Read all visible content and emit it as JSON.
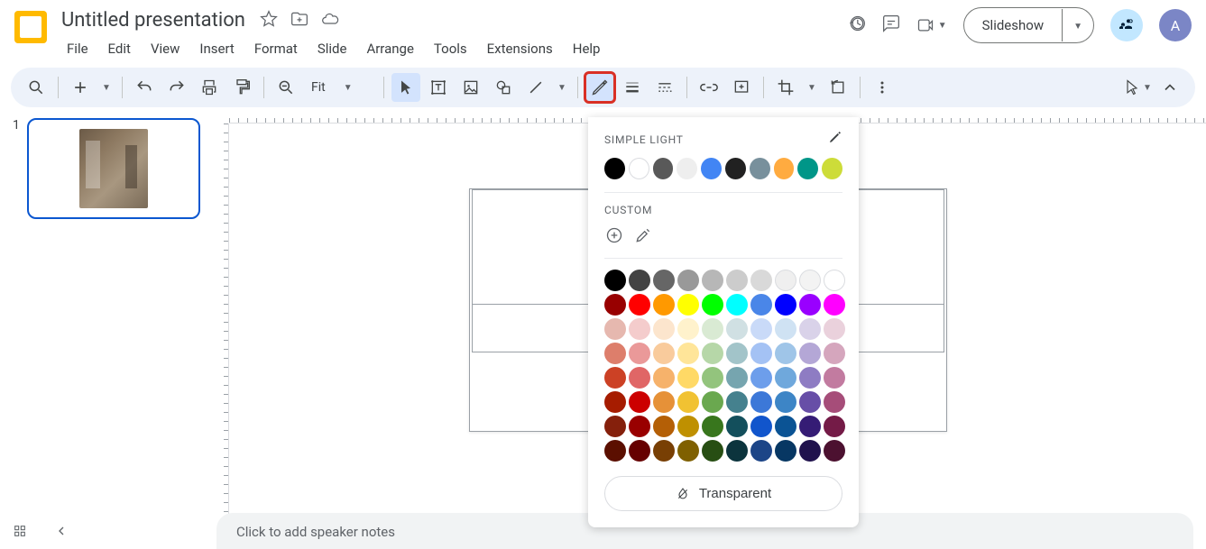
{
  "header": {
    "title": "Untitled presentation",
    "avatar_initial": "A",
    "slideshow_label": "Slideshow"
  },
  "menus": [
    "File",
    "Edit",
    "View",
    "Insert",
    "Format",
    "Slide",
    "Arrange",
    "Tools",
    "Extensions",
    "Help"
  ],
  "toolbar": {
    "zoom_label": "Fit"
  },
  "sidebar": {
    "slides": [
      {
        "number": "1"
      }
    ]
  },
  "notes": {
    "placeholder": "Click to add speaker notes"
  },
  "popover": {
    "section1_title": "SIMPLE LIGHT",
    "section2_title": "CUSTOM",
    "transparent_label": "Transparent",
    "theme_colors": [
      "#000000",
      "#ffffff",
      "#595959",
      "#eeeeee",
      "#4285f4",
      "#212121",
      "#78909c",
      "#ffab40",
      "#009688",
      "#cddc39"
    ],
    "palette_rows": [
      [
        "#000000",
        "#434343",
        "#666666",
        "#999999",
        "#b7b7b7",
        "#cccccc",
        "#d9d9d9",
        "#efefef",
        "#f3f3f3",
        "#ffffff"
      ],
      [
        "#980000",
        "#ff0000",
        "#ff9900",
        "#ffff00",
        "#00ff00",
        "#00ffff",
        "#4a86e8",
        "#0000ff",
        "#9900ff",
        "#ff00ff"
      ],
      [
        "#e6b8af",
        "#f4cccc",
        "#fce5cd",
        "#fff2cc",
        "#d9ead3",
        "#d0e0e3",
        "#c9daf8",
        "#cfe2f3",
        "#d9d2e9",
        "#ead1dc"
      ],
      [
        "#dd7e6b",
        "#ea9999",
        "#f9cb9c",
        "#ffe599",
        "#b6d7a8",
        "#a2c4c9",
        "#a4c2f4",
        "#9fc5e8",
        "#b4a7d6",
        "#d5a6bd"
      ],
      [
        "#cc4125",
        "#e06666",
        "#f6b26b",
        "#ffd966",
        "#93c47d",
        "#76a5af",
        "#6d9eeb",
        "#6fa8dc",
        "#8e7cc3",
        "#c27ba0"
      ],
      [
        "#a61c00",
        "#cc0000",
        "#e69138",
        "#f1c232",
        "#6aa84f",
        "#45818e",
        "#3c78d8",
        "#3d85c6",
        "#674ea7",
        "#a64d79"
      ],
      [
        "#85200c",
        "#990000",
        "#b45f06",
        "#bf9000",
        "#38761d",
        "#134f5c",
        "#1155cc",
        "#0b5394",
        "#351c75",
        "#741b47"
      ],
      [
        "#5b0f00",
        "#660000",
        "#783f04",
        "#7f6000",
        "#274e13",
        "#0c343d",
        "#1c4587",
        "#073763",
        "#20124d",
        "#4c1130"
      ]
    ]
  }
}
